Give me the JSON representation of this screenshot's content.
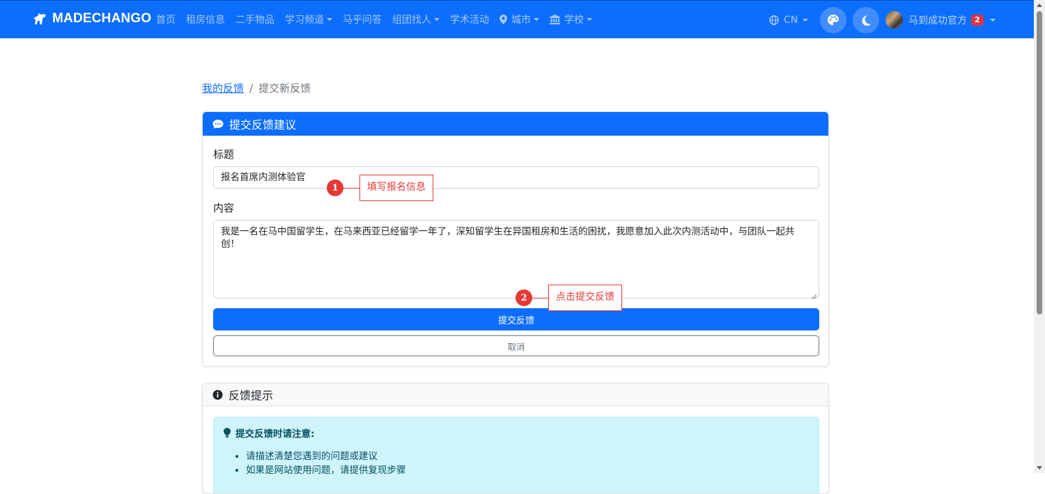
{
  "navbar": {
    "brand": "MADECHANGO",
    "links": [
      {
        "label": "首页",
        "dropdown": false
      },
      {
        "label": "租房信息",
        "dropdown": false
      },
      {
        "label": "二手物品",
        "dropdown": false
      },
      {
        "label": "学习频道",
        "dropdown": true
      },
      {
        "label": "马乎问答",
        "dropdown": false
      },
      {
        "label": "组团找人",
        "dropdown": true
      },
      {
        "label": "学术活动",
        "dropdown": false
      }
    ],
    "city_label": "城市",
    "school_label": "学校",
    "language": "CN",
    "user_name": "马到成功官方",
    "notification_count": "2"
  },
  "breadcrumb": {
    "parent": "我的反馈",
    "separator": "/",
    "current": "提交新反馈"
  },
  "form": {
    "header": "提交反馈建议",
    "title_label": "标题",
    "title_value": "报名首席内测体验官",
    "content_label": "内容",
    "content_value": "我是一名在马中国留学生，在马来西亚已经留学一年了，深知留学生在异国租房和生活的困扰，我愿意加入此次内测活动中，与团队一起共创！",
    "submit_label": "提交反馈",
    "cancel_label": "取消"
  },
  "tips": {
    "header": "反馈提示",
    "alert_title": "提交反馈时请注意:",
    "items": [
      "请描述清楚您遇到的问题或建议",
      "如果是网站使用问题，请提供复现步骤"
    ]
  },
  "annotations": [
    {
      "number": "1",
      "text": "填写报名信息"
    },
    {
      "number": "2",
      "text": "点击提交反馈"
    }
  ],
  "colors": {
    "primary": "#0d6efd",
    "annotation": "#e53935",
    "alert_bg": "#cff4fc",
    "badge": "#dc3545"
  }
}
